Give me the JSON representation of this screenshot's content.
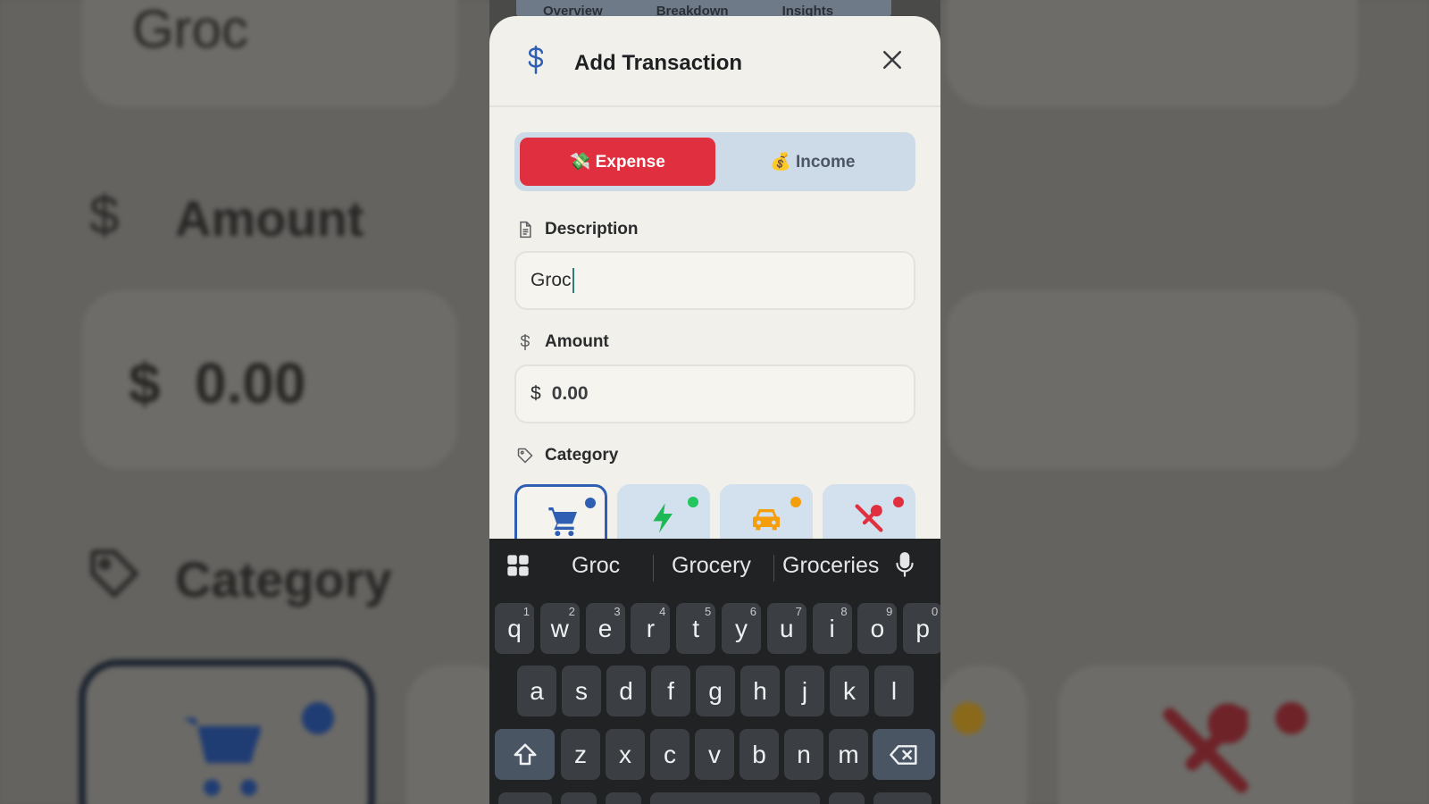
{
  "background": {
    "description_value": "Groc",
    "amount_label": "Amount",
    "amount_value": "0.00",
    "currency_symbol": "$",
    "category_label": "Category"
  },
  "top_tabs": [
    "Overview",
    "Breakdown",
    "Insights"
  ],
  "dialog": {
    "title": "Add Transaction",
    "type_toggle": {
      "expense_label": "💸 Expense",
      "income_label": "💰 Income",
      "selected": "expense"
    },
    "description": {
      "label": "Description",
      "value": "Groc"
    },
    "amount": {
      "label": "Amount",
      "prefix": "$",
      "placeholder": "0.00"
    },
    "category": {
      "label": "Category",
      "items": [
        {
          "icon": "cart-icon",
          "color": "#2f5fb3",
          "dot_color": "#2f5fb3",
          "selected": true
        },
        {
          "icon": "bolt-icon",
          "color": "#1db954",
          "dot_color": "#22c55e",
          "selected": false
        },
        {
          "icon": "car-icon",
          "color": "#f59e0b",
          "dot_color": "#f59e0b",
          "selected": false
        },
        {
          "icon": "utensils-icon",
          "color": "#e0303f",
          "dot_color": "#e0303f",
          "selected": false
        }
      ]
    }
  },
  "keyboard": {
    "suggestions": [
      "Groc",
      "Grocery",
      "Groceries"
    ],
    "row1": [
      {
        "k": "q",
        "n": "1"
      },
      {
        "k": "w",
        "n": "2"
      },
      {
        "k": "e",
        "n": "3"
      },
      {
        "k": "r",
        "n": "4"
      },
      {
        "k": "t",
        "n": "5"
      },
      {
        "k": "y",
        "n": "6"
      },
      {
        "k": "u",
        "n": "7"
      },
      {
        "k": "i",
        "n": "8"
      },
      {
        "k": "o",
        "n": "9"
      },
      {
        "k": "p",
        "n": "0"
      }
    ],
    "row2": [
      "a",
      "s",
      "d",
      "f",
      "g",
      "h",
      "j",
      "k",
      "l"
    ],
    "row3": [
      "z",
      "x",
      "c",
      "v",
      "b",
      "n",
      "m"
    ]
  },
  "colors": {
    "expense_active": "#e0303f",
    "toggle_track": "#cddbe9",
    "accent_blue": "#2f5fb3",
    "keyboard_bg": "#202224",
    "key_bg": "#3b3e42"
  }
}
